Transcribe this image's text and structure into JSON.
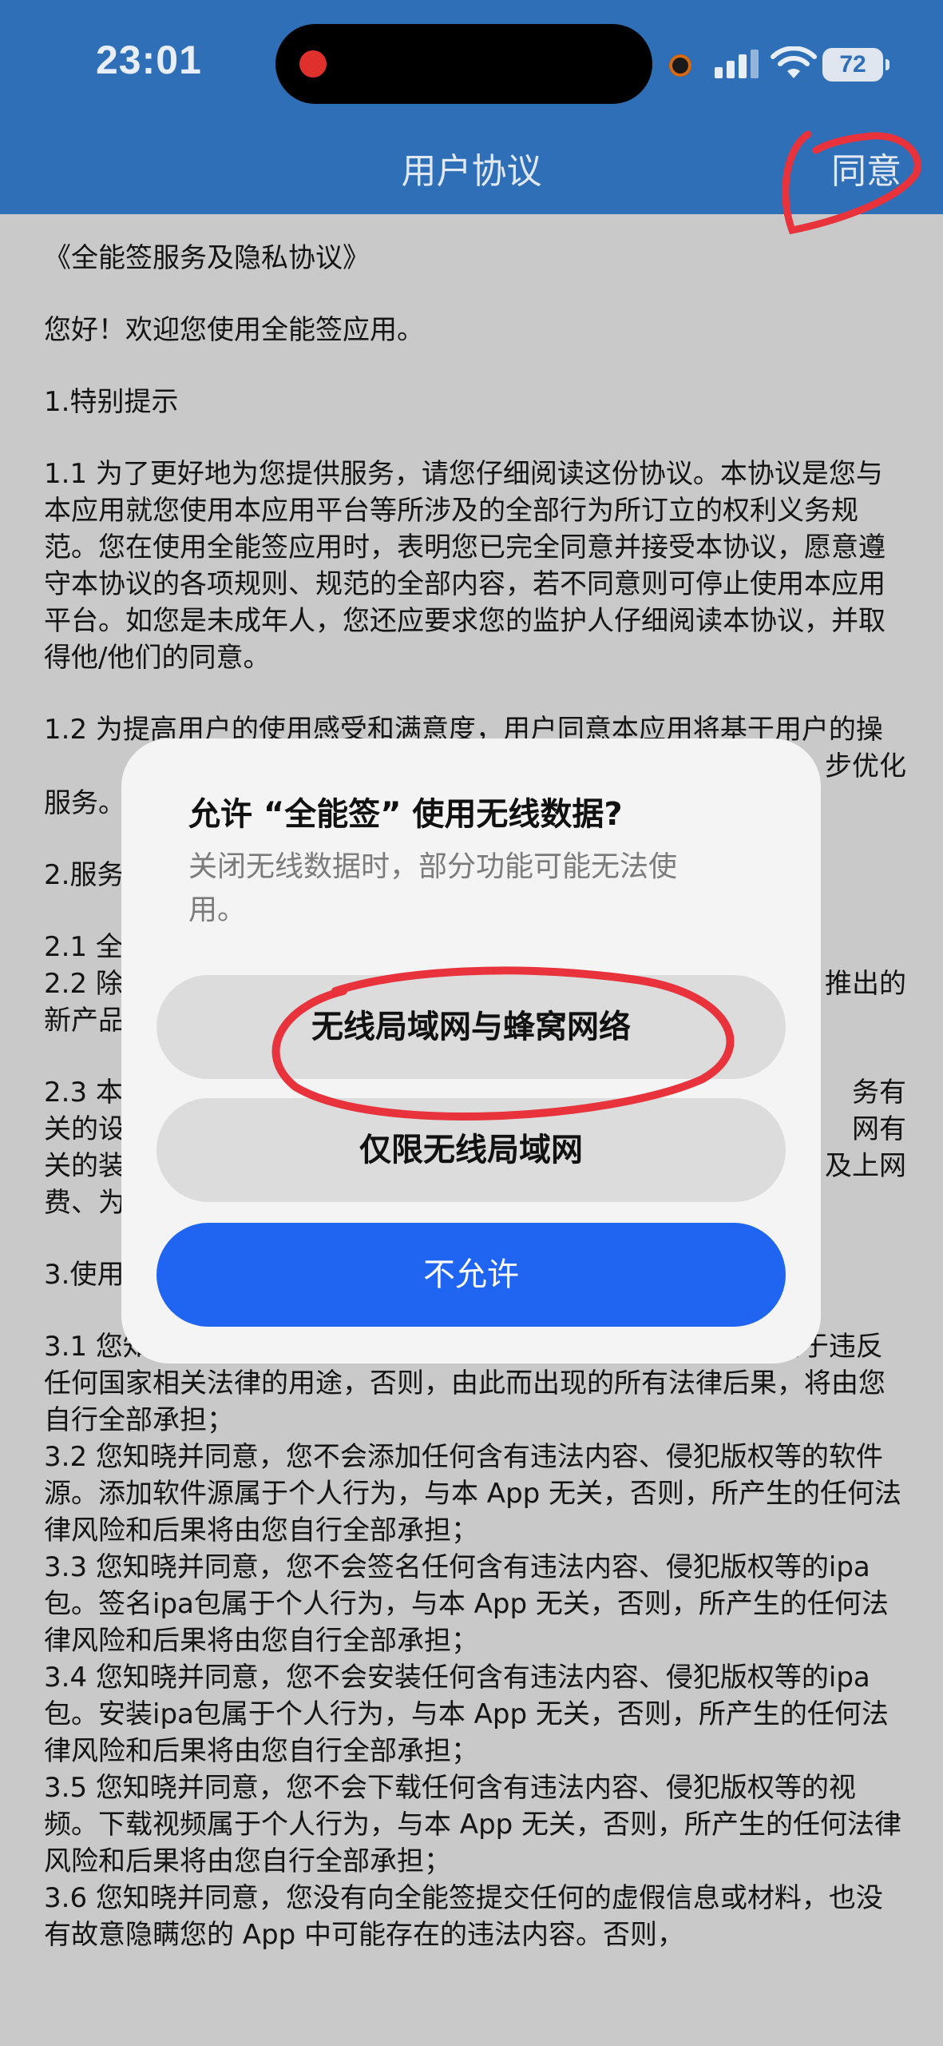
{
  "status_bar": {
    "time": "23:01",
    "battery": "72"
  },
  "nav": {
    "title": "用户协议",
    "agree_label": "同意"
  },
  "content": {
    "paragraphs": [
      "《全能签服务及隐私协议》",
      "您好！欢迎您使用全能签应用。",
      "1.特别提示",
      "1.1 为了更好地为您提供服务，请您仔细阅读这份协议。本协议是您与本应用就您使用本应用平台等所涉及的全部行为所订立的权利义务规范。您在使用全能签应用时，表明您已完全同意并接受本协议，愿意遵守本协议的各项规则、规范的全部内容，若不同意则可停止使用本应用平台。如您是未成年人，您还应要求您的监护人仔细阅读本协议，并取得他/他们的同意。",
      "1.2 为提高用户的使用感受和满意度，用户同意本应用将基于用户的操",
      "步优化",
      "服务。",
      "2.服务",
      "2.1 全",
      "2.2 除",
      "推出的",
      "新产品",
      "2.3 本",
      "务有",
      "关的设",
      "网有",
      "关的装",
      "及上网",
      "费、为",
      "3.使用",
      "3.1 您知晓并同意，您并不会将全能签所提供的任何一项服务用于违反任何国家相关法律的用途，否则，由此而出现的所有法律后果，将由您自行全部承担；",
      "3.2 您知晓并同意，您不会添加任何含有违法内容、侵犯版权等的软件源。添加软件源属于个人行为，与本 App 无关，否则，所产生的任何法律风险和后果将由您自行全部承担；",
      "3.3 您知晓并同意，您不会签名任何含有违法内容、侵犯版权等的ipa包。签名ipa包属于个人行为，与本 App 无关，否则，所产生的任何法律风险和后果将由您自行全部承担；",
      "3.4 您知晓并同意，您不会安装任何含有违法内容、侵犯版权等的ipa包。安装ipa包属于个人行为，与本 App 无关，否则，所产生的任何法律风险和后果将由您自行全部承担；",
      "3.5 您知晓并同意，您不会下载任何含有违法内容、侵犯版权等的视频。下载视频属于个人行为，与本 App 无关，否则，所产生的任何法律风险和后果将由您自行全部承担；",
      "3.6 您知晓并同意，您没有向全能签提交任何的虚假信息或材料，也没有故意隐瞒您的 App 中可能存在的违法内容。否则，"
    ]
  },
  "dialog": {
    "title": "允许 “全能签” 使用无线数据?",
    "message": "关闭无线数据时，部分功能可能无法使用。",
    "options": [
      "无线局域网与蜂窝网络",
      "仅限无线局域网"
    ],
    "deny_label": "不允许"
  },
  "colors": {
    "header": "#2f6fb8",
    "accent_blue": "#1f65f2",
    "annotation_red": "#e8323c"
  },
  "icons": [
    "recording-dot-icon",
    "camera-dot-icon",
    "signal-icon",
    "wifi-icon",
    "battery-icon"
  ]
}
